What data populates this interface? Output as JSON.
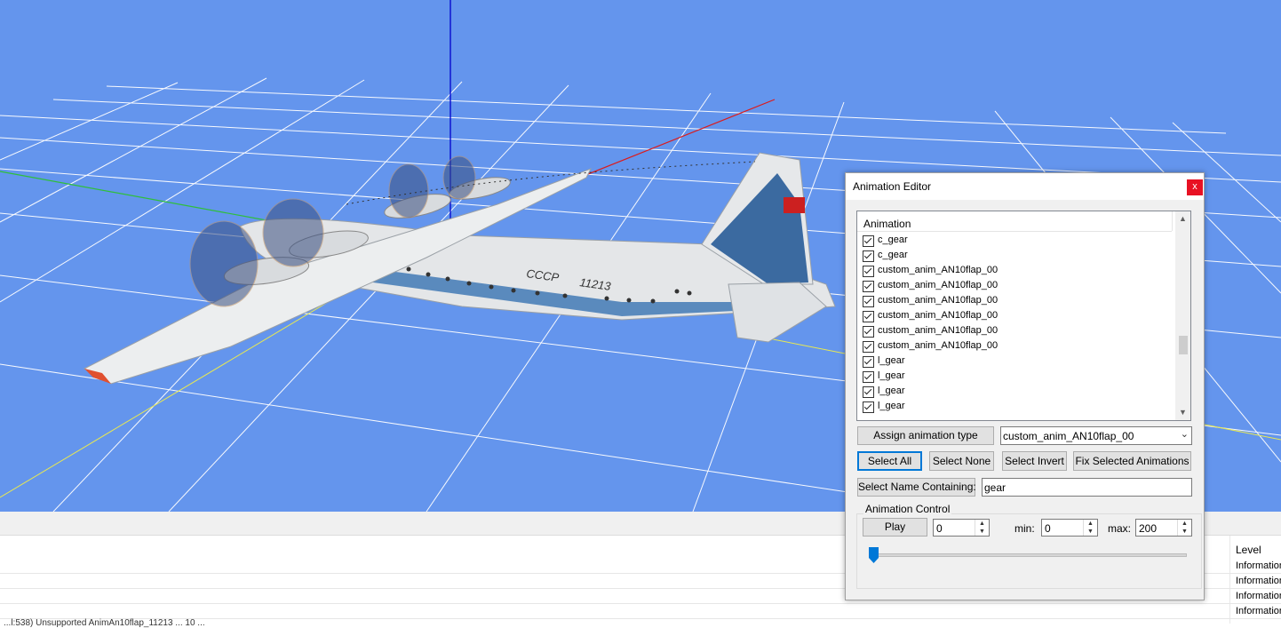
{
  "viewport": {
    "aircraft_marking": "СССР",
    "aircraft_registration": "11213"
  },
  "animation_editor": {
    "title": "Animation Editor",
    "close_label": "x",
    "list_header": "Animation",
    "items": [
      {
        "label": "c_gear",
        "checked": true
      },
      {
        "label": "c_gear",
        "checked": true
      },
      {
        "label": "custom_anim_AN10flap_00",
        "checked": true
      },
      {
        "label": "custom_anim_AN10flap_00",
        "checked": true
      },
      {
        "label": "custom_anim_AN10flap_00",
        "checked": true
      },
      {
        "label": "custom_anim_AN10flap_00",
        "checked": true
      },
      {
        "label": "custom_anim_AN10flap_00",
        "checked": true
      },
      {
        "label": "custom_anim_AN10flap_00",
        "checked": true
      },
      {
        "label": "l_gear",
        "checked": true
      },
      {
        "label": "l_gear",
        "checked": true
      },
      {
        "label": "l_gear",
        "checked": true
      },
      {
        "label": "l_gear",
        "checked": true
      }
    ],
    "assign_button": "Assign animation type",
    "animation_type_selected": "custom_anim_AN10flap_00",
    "select_all": "Select All",
    "select_none": "Select None",
    "select_invert": "Select Invert",
    "fix_selected": "Fix Selected Animations",
    "select_name_containing": "Select Name Containing:",
    "name_filter_value": "gear",
    "control": {
      "group_title": "Animation Control",
      "play": "Play",
      "frame_value": "0",
      "min_label": "min:",
      "min_value": "0",
      "max_label": "max:",
      "max_value": "200",
      "slider_value": 0
    }
  },
  "log": {
    "level_header": "Level",
    "rows": [
      {
        "level": "Information"
      },
      {
        "level": "Information"
      },
      {
        "level": "Information"
      },
      {
        "level": "Information"
      }
    ],
    "partial_message": "...l:538) Unsupported AnimAn10flap_11213 ... 10 ..."
  }
}
